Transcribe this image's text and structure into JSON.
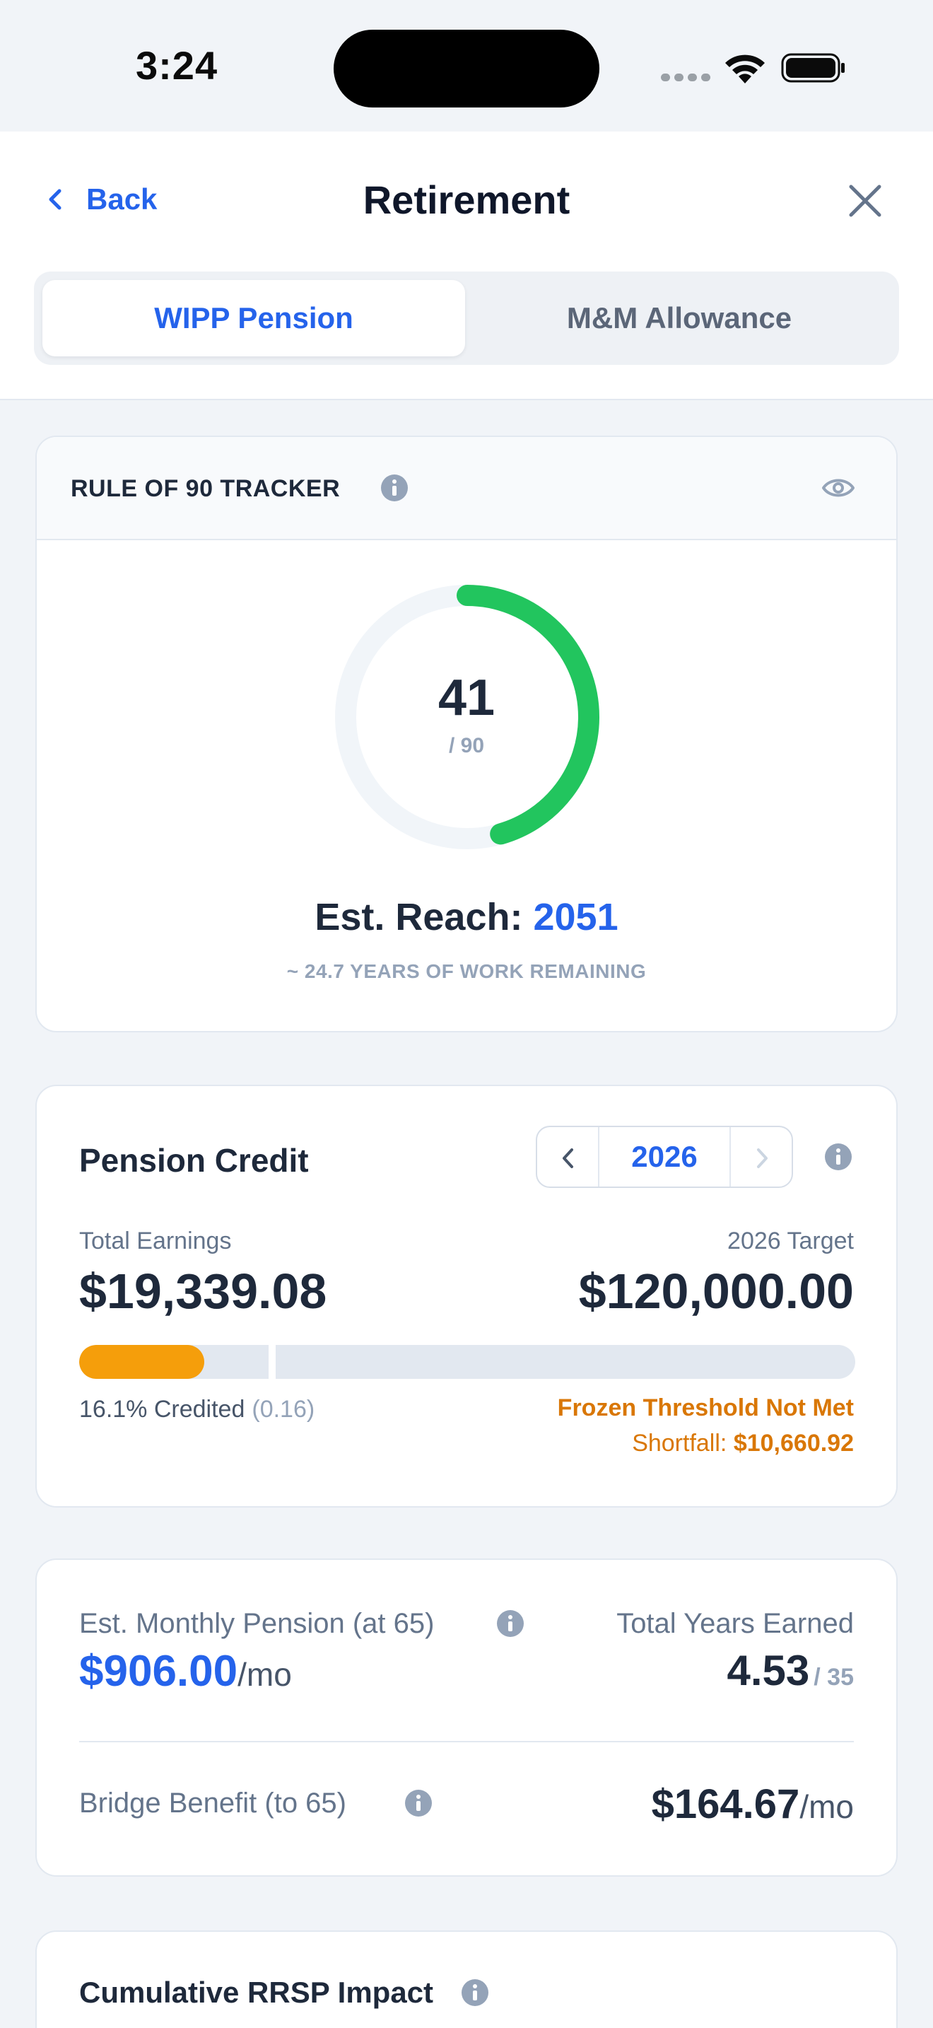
{
  "status_bar": {
    "time": "3:24"
  },
  "nav": {
    "back_label": "Back",
    "title": "Retirement",
    "tabs": [
      {
        "label": "WIPP Pension",
        "active": true
      },
      {
        "label": "M&M Allowance",
        "active": false
      }
    ]
  },
  "rule_of_90": {
    "title": "RULE OF 90 TRACKER",
    "score": "41",
    "target": "/ 90",
    "progress_fraction": 0.4556,
    "est_reach_label": "Est. Reach:",
    "est_reach_year": "2051",
    "remaining_text": "~ 24.7 YEARS OF WORK REMAINING"
  },
  "pension_credit": {
    "title": "Pension Credit",
    "year": "2026",
    "total_earnings_label": "Total Earnings",
    "total_earnings": "$19,339.08",
    "target_label": "2026 Target",
    "target_amount": "$120,000.00",
    "progress_fraction": 0.161,
    "credited_text": "16.1% Credited",
    "credited_ratio": "(0.16)",
    "status_text": "Frozen Threshold Not Met",
    "shortfall_label": "Shortfall:",
    "shortfall_amount": "$10,660.92"
  },
  "monthly": {
    "pension_label": "Est. Monthly Pension (at 65)",
    "pension_amount": "$906.00",
    "pension_unit": "/mo",
    "years_label": "Total Years Earned",
    "years_value": "4.53",
    "years_of": "/ 35",
    "bridge_label": "Bridge Benefit (to 65)",
    "bridge_amount": "$164.67",
    "bridge_unit": "/mo"
  },
  "rrsp": {
    "title": "Cumulative RRSP Impact"
  },
  "colors": {
    "accent": "#2563eb",
    "gauge": "#22c55e",
    "warning": "#f59e0b",
    "warning_text": "#d97706"
  },
  "icons": [
    "back-chevron-icon",
    "close-icon",
    "info-icon",
    "eye-icon",
    "wifi-icon",
    "battery-icon",
    "signal-icon"
  ]
}
